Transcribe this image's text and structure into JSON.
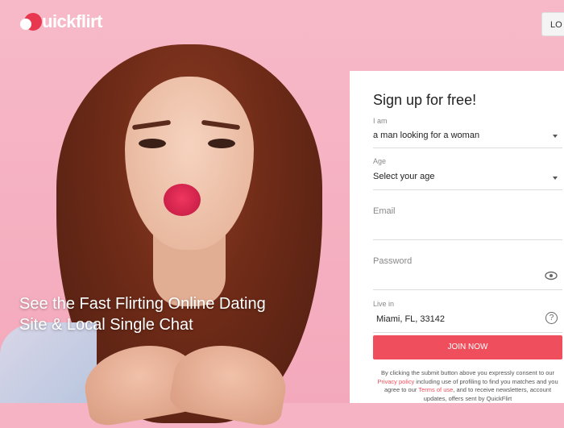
{
  "brand": {
    "name": "Quickflirt",
    "logo_text": "uickflirt"
  },
  "header": {
    "login_label": "LO"
  },
  "hero": {
    "tagline": "See the Fast Flirting Online Dating Site & Local Single Chat"
  },
  "signup": {
    "title": "Sign up for free!",
    "i_am": {
      "label": "I am",
      "value": "a man looking for a woman"
    },
    "age": {
      "label": "Age",
      "value": "Select your age"
    },
    "email": {
      "placeholder": "Email"
    },
    "password": {
      "placeholder": "Password"
    },
    "live_in": {
      "label": "Live in",
      "value": "Miami, FL, 33142"
    },
    "submit_label": "JOIN NOW",
    "legal": {
      "part1": "By clicking the submit button above you expressly consent to our ",
      "privacy_link": "Privacy policy",
      "part2": " including use of profiling to find you matches and you agree to our ",
      "terms_link": "Terms of use",
      "part3": ", and to receive newsletters, account updates, offers sent by QuickFlirt"
    }
  },
  "colors": {
    "accent": "#ef4f5c",
    "background": "#f6b3c3"
  },
  "icons": [
    "quickflirt-logo-icon",
    "chevron-down-icon",
    "eye-icon",
    "question-circle-icon"
  ]
}
